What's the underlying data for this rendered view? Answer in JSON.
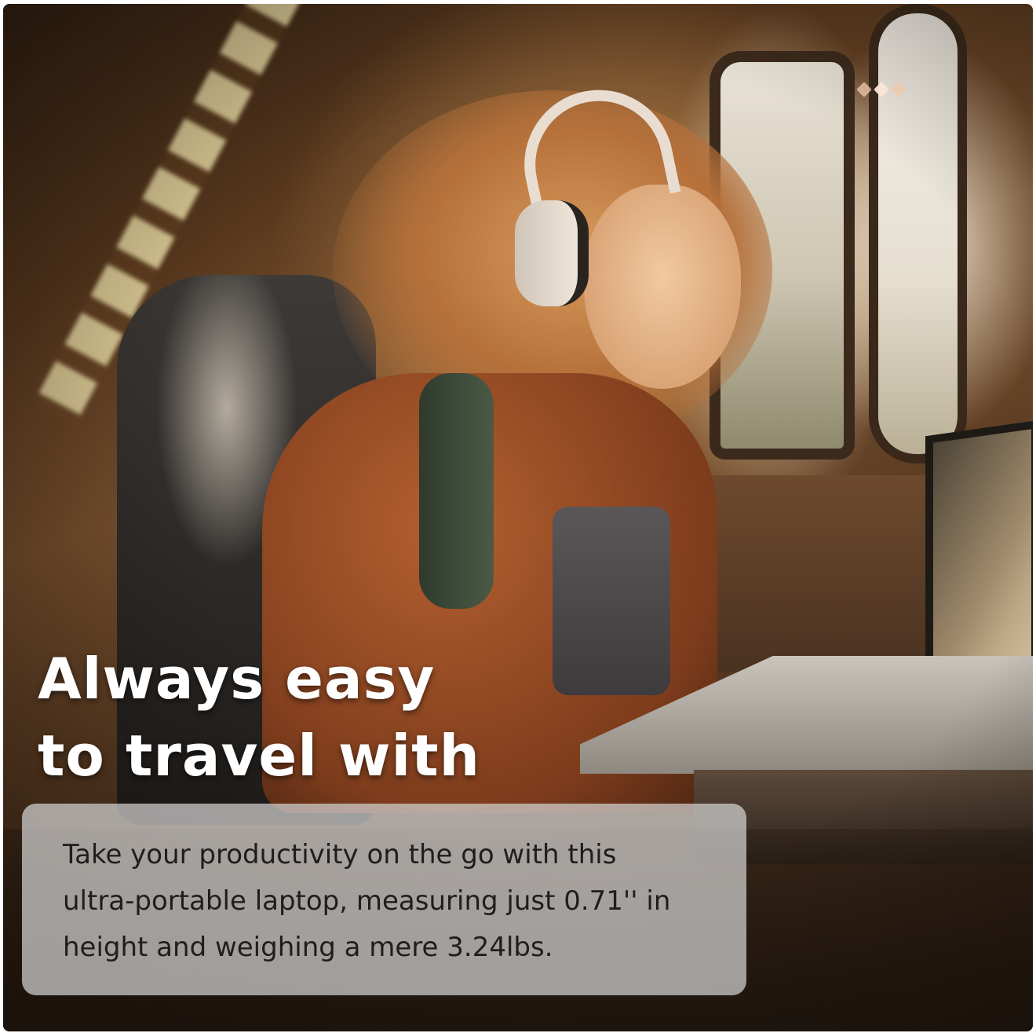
{
  "hero": {
    "headline_line1": "Always easy",
    "headline_line2": "to travel with",
    "caption": "Take your productivity on the go with this ultra-portable laptop, measuring just 0.71'' in height and weighing a mere 3.24lbs."
  },
  "carousel": {
    "dots": [
      {
        "icon": "diamond-dot-icon",
        "active": false
      },
      {
        "icon": "diamond-dot-icon",
        "active": true
      },
      {
        "icon": "diamond-dot-icon",
        "active": false
      }
    ]
  },
  "colors": {
    "headline_text": "#ffffff",
    "caption_text": "#1e1e1e",
    "caption_box": "rgba(210,210,210,0.72)"
  }
}
